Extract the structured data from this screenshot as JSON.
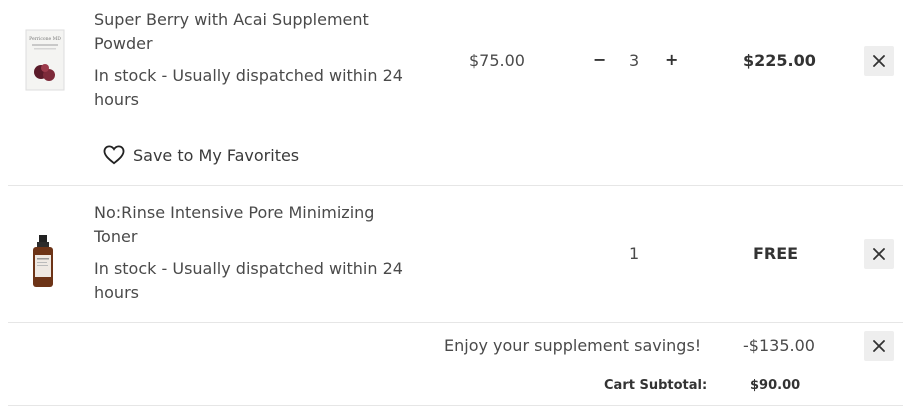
{
  "items": [
    {
      "name": "Super Berry with Acai Supplement Powder",
      "stock": "In stock  -  Usually dispatched within 24 hours",
      "unit_price": "$75.00",
      "quantity": "3",
      "minus": "−",
      "plus": "+",
      "total": "$225.00",
      "brand_mark": "Perricone MD",
      "favorite_label": "Save to My Favorites"
    },
    {
      "name": "No:Rinse Intensive Pore Minimizing Toner",
      "stock": "In stock  -  Usually dispatched within 24 hours",
      "quantity": "1",
      "total": "FREE"
    }
  ],
  "promo": {
    "label": "Enjoy your supplement savings!",
    "amount": "-$135.00"
  },
  "subtotal": {
    "label": "Cart Subtotal:",
    "amount": "$90.00"
  },
  "icons": {
    "remove": "close-icon",
    "favorite": "heart-icon"
  },
  "colors": {
    "remove_bg": "#eeeeee",
    "divider": "#e6e6e6"
  }
}
